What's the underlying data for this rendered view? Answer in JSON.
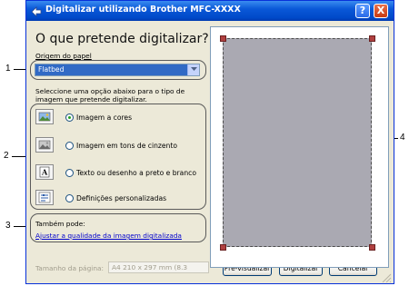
{
  "window": {
    "title": "Digitalizar utilizando Brother MFC-XXXX",
    "help_label": "?",
    "close_label": "X"
  },
  "heading": "O que pretende digitalizar?",
  "paper_source": {
    "label": "Origem do papel",
    "value": "Flatbed"
  },
  "instruction": "Seleccione uma opção abaixo para o tipo de imagem que pretende digitalizar.",
  "options": [
    {
      "label": "Imagem a cores",
      "selected": true,
      "icon": "color-image-icon"
    },
    {
      "label": "Imagem em tons de cinzento",
      "selected": false,
      "icon": "grayscale-image-icon"
    },
    {
      "label": "Texto ou desenho a preto e branco",
      "selected": false,
      "icon": "black-white-text-icon"
    },
    {
      "label": "Definições personalizadas",
      "selected": false,
      "icon": "custom-settings-icon"
    }
  ],
  "also": {
    "label": "Também pode:",
    "link": "Ajustar a qualidade da imagem digitalizada"
  },
  "page_size": {
    "label": "Tamanho da página:",
    "value": "A4 210 x 297 mm (8.3"
  },
  "buttons": {
    "preview": "Pré-visualizar",
    "scan": "Digitalizar",
    "cancel": "Cancelar"
  },
  "callouts": [
    "1",
    "2",
    "3",
    "4"
  ],
  "colors": {
    "titlebar": "#0a58d8",
    "dialog": "#ece9d8",
    "scan_area": "#aaa9b2",
    "handle": "#b04040",
    "link": "#0000cc"
  }
}
